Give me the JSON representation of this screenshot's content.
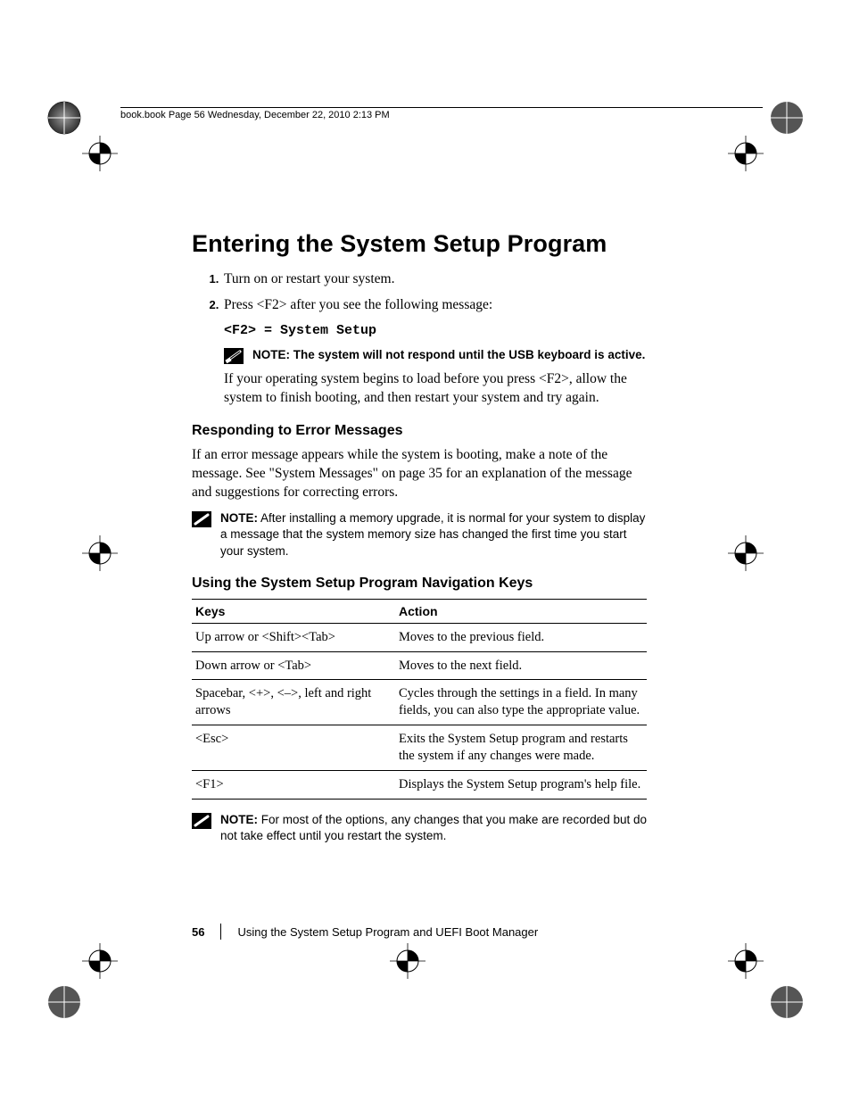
{
  "header_strip": "book.book  Page 56  Wednesday, December 22, 2010  2:13 PM",
  "title": "Entering the System Setup Program",
  "steps": [
    {
      "num": "1",
      "text": "Turn on or restart your system."
    },
    {
      "num": "2",
      "text": "Press <F2> after you see the following message:"
    }
  ],
  "code_line": "<F2> = System Setup",
  "note1_label": "NOTE:",
  "note1_text": " The system will not respond until the USB keyboard is active.",
  "step2_para": "If your operating system begins to load before you press <F2>, allow the system to finish booting, and then restart your system and try again.",
  "h2_error": "Responding to Error Messages",
  "error_para": "If an error message appears while the system is booting, make a note of the message. See \"System Messages\" on page 35 for an explanation of the message and suggestions for correcting errors.",
  "note2_label": "NOTE:",
  "note2_text": " After installing a memory upgrade, it is normal for your system to display a message that the system memory size has changed the first time you start your system.",
  "h2_nav": "Using the System Setup Program Navigation Keys",
  "table": {
    "headers": [
      "Keys",
      "Action"
    ],
    "rows": [
      [
        "Up arrow or <Shift><Tab>",
        "Moves to the previous field."
      ],
      [
        "Down arrow or <Tab>",
        "Moves to the next field."
      ],
      [
        "Spacebar, <+>, <–>, left and right arrows",
        "Cycles through the settings in a field. In many fields, you can also type the appropriate value."
      ],
      [
        "<Esc>",
        "Exits the System Setup program and restarts the system if any changes were made."
      ],
      [
        "<F1>",
        "Displays the System Setup program's help file."
      ]
    ]
  },
  "note3_label": "NOTE:",
  "note3_text": " For most of the options, any changes that you make are recorded but do not take effect until you restart the system.",
  "footer_page": "56",
  "footer_title": "Using the System Setup Program and UEFI Boot Manager"
}
